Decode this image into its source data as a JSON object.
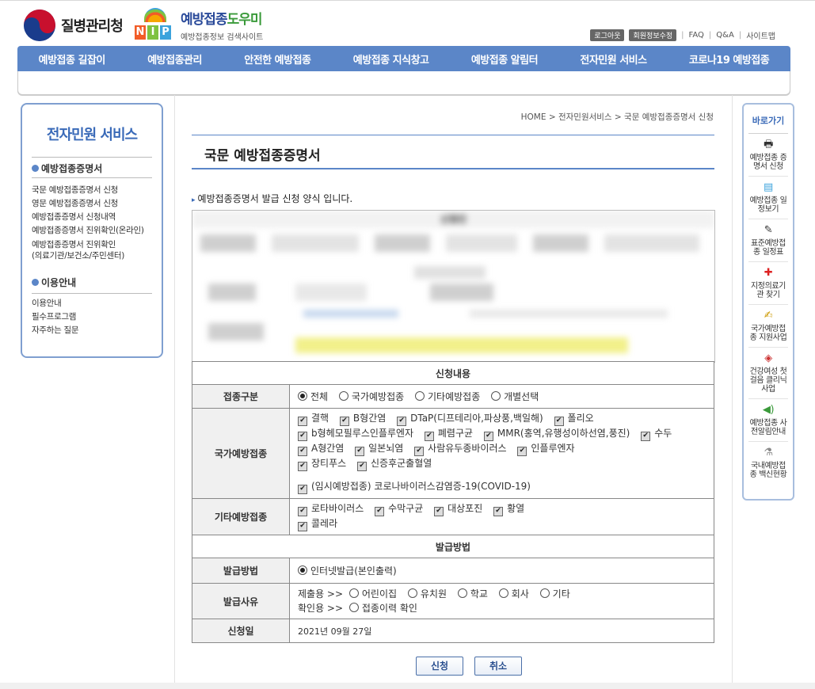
{
  "header": {
    "kdca_name": "질병관리청",
    "nip_letters": [
      "N",
      "I",
      "P"
    ],
    "nip_title_a": "예방접종",
    "nip_title_b": "도우미",
    "nip_subtitle": "예방접종정보 검색사이트",
    "util": {
      "logout": "로그아웃",
      "member_edit": "회원정보수정",
      "faq": "FAQ",
      "qna": "Q&A",
      "sitemap": "사이트맵"
    }
  },
  "nav": [
    "예방접종 길잡이",
    "예방접종관리",
    "안전한 예방접종",
    "예방접종 지식창고",
    "예방접종 알림터",
    "전자민원 서비스",
    "코로나19 예방접종"
  ],
  "sidebar": {
    "title": "전자민원 서비스",
    "section1": "예방접종증명서",
    "items1": [
      "국문 예방접종증명서 신청",
      "영문 예방접종증명서 신청",
      "예방접종증명서 신청내역",
      "예방접종증명서 진위확인(온라인)",
      "예방접종증명서 진위확인",
      "(의료기관/보건소/주민센터)"
    ],
    "section2": "이용안내",
    "items2": [
      "이용안내",
      "필수프로그램",
      "자주하는 질문"
    ]
  },
  "breadcrumb": "HOME > 전자민원서비스 > 국문 예방접종증명서 신청",
  "page_title": "국문 예방접종증명서",
  "intro": "예방접종증명서 발급 신청 양식 입니다.",
  "applicant_header": "신청인",
  "form": {
    "section_content": "신청내용",
    "vacc_type_label": "접종구분",
    "vacc_type_options": [
      "전체",
      "국가예방접종",
      "기타예방접종",
      "개별선택"
    ],
    "national_label": "국가예방접종",
    "national_rows": [
      [
        "결핵",
        "B형간염",
        "DTaP(디프테리아,파상풍,백일해)",
        "폴리오"
      ],
      [
        "b형헤모필루스인플루엔자",
        "폐렴구균",
        "MMR(홍역,유행성이하선염,풍진)",
        "수두"
      ],
      [
        "A형간염",
        "일본뇌염",
        "사람유두종바이러스",
        "인플루엔자"
      ],
      [
        "장티푸스",
        "신증후군출혈열"
      ]
    ],
    "national_covid": "(임시예방접종) 코로나바이러스감염증-19(COVID-19)",
    "other_label": "기타예방접종",
    "other_rows": [
      [
        "로타바이러스",
        "수막구균",
        "대상포진",
        "황열"
      ],
      [
        "콜레라"
      ]
    ],
    "section_issue": "발급방법",
    "method_label": "발급방법",
    "method_option": "인터넷발급(본인출력)",
    "reason_label": "발급사유",
    "reason_submit_prefix": "제출용 >>",
    "reason_submit_options": [
      "어린이집",
      "유치원",
      "학교",
      "회사",
      "기타"
    ],
    "reason_confirm_prefix": "확인용 >>",
    "reason_confirm_option": "접종이력 확인",
    "date_label": "신청일",
    "date_value": "2021년 09월 27일"
  },
  "buttons": {
    "apply": "신청",
    "cancel": "취소"
  },
  "quick": {
    "title": "바로가기",
    "items": [
      {
        "icon": "printer-icon",
        "label": "예방접종 증명서 신청"
      },
      {
        "icon": "calendar-icon",
        "label": "예방접종 일정보기"
      },
      {
        "icon": "syringe-icon",
        "label": "표준예방접종 일정표"
      },
      {
        "icon": "hospital-icon",
        "label": "지정의료기관 찾기"
      },
      {
        "icon": "document-icon",
        "label": "국가예방접종 지원사업"
      },
      {
        "icon": "vaccine-box-icon",
        "label": "건강여성 첫걸음 클리닉사업"
      },
      {
        "icon": "speaker-icon",
        "label": "예방접종 사전알림안내"
      },
      {
        "icon": "vial-icon",
        "label": "국내예방접종 백신현황"
      }
    ]
  }
}
